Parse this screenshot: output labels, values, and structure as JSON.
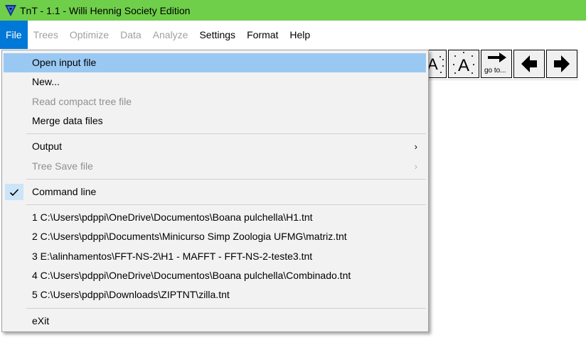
{
  "window": {
    "title": "TnT - 1.1 - Willi Hennig Society Edition",
    "icon": "tnt-logo-icon",
    "title_bar_color": "#6fcf4a"
  },
  "menubar": {
    "items": [
      {
        "label": "File",
        "state": "active"
      },
      {
        "label": "Trees",
        "state": "disabled"
      },
      {
        "label": "Optimize",
        "state": "disabled"
      },
      {
        "label": "Data",
        "state": "disabled"
      },
      {
        "label": "Analyze",
        "state": "disabled"
      },
      {
        "label": "Settings",
        "state": "enabled"
      },
      {
        "label": "Format",
        "state": "enabled"
      },
      {
        "label": "Help",
        "state": "enabled"
      }
    ]
  },
  "toolbar": {
    "buttons": [
      {
        "icon": "partial-letter-a-icon",
        "text": "A"
      },
      {
        "icon": "letter-a-icon",
        "text": "A"
      },
      {
        "icon": "go-to-icon",
        "text": "go to..."
      },
      {
        "icon": "arrow-left-icon"
      },
      {
        "icon": "arrow-right-icon"
      }
    ]
  },
  "file_menu": {
    "items": [
      {
        "label": "Open input file",
        "state": "highlighted"
      },
      {
        "label": "New...",
        "state": "enabled"
      },
      {
        "label": "Read compact tree file",
        "state": "disabled"
      },
      {
        "label": "Merge data files",
        "state": "enabled"
      },
      {
        "label": "Output",
        "state": "enabled",
        "submenu": true
      },
      {
        "label": "Tree Save file",
        "state": "disabled",
        "submenu": true
      },
      {
        "label": "Command line",
        "state": "checked"
      },
      {
        "label": "1 C:\\Users\\pdppi\\OneDrive\\Documentos\\Boana pulchella\\H1.tnt",
        "state": "enabled"
      },
      {
        "label": "2 C:\\Users\\pdppi\\Documents\\Minicurso Simp Zoologia UFMG\\matriz.tnt",
        "state": "enabled"
      },
      {
        "label": "3 E:\\alinhamentos\\FFT-NS-2\\H1 - MAFFT - FFT-NS-2-teste3.tnt",
        "state": "enabled"
      },
      {
        "label": "4 C:\\Users\\pdppi\\OneDrive\\Documentos\\Boana pulchella\\Combinado.tnt",
        "state": "enabled"
      },
      {
        "label": "5 C:\\Users\\pdppi\\Downloads\\ZIPTNT\\zilla.tnt",
        "state": "enabled"
      },
      {
        "label": "eXit",
        "state": "enabled"
      }
    ],
    "submenu_arrow": "›",
    "highlight_color": "#99c9f3"
  }
}
